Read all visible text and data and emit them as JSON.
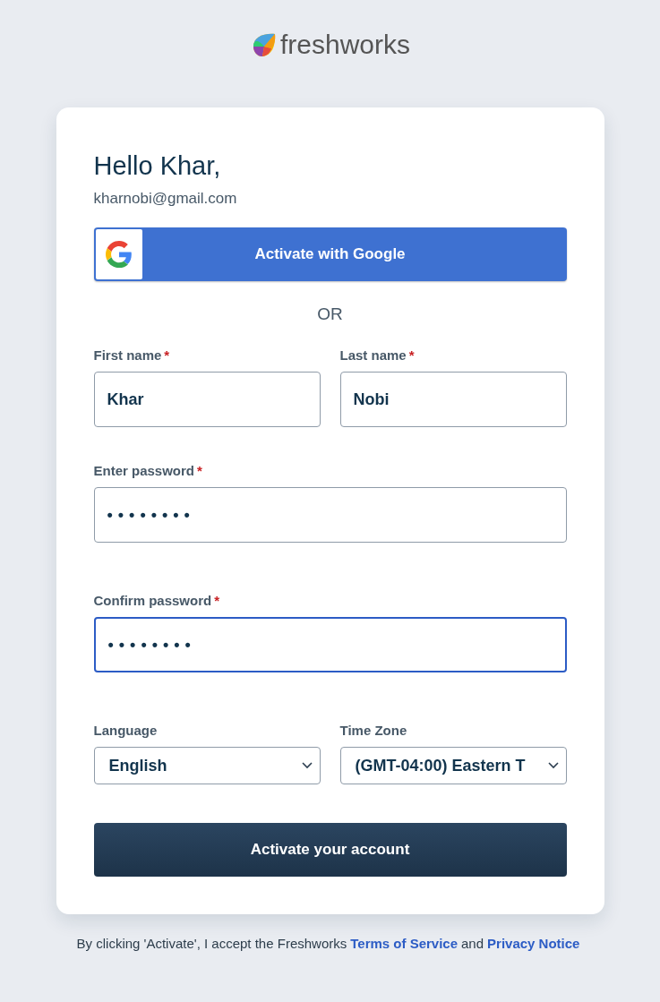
{
  "logo": {
    "text": "freshworks"
  },
  "greeting": "Hello Khar,",
  "email": "kharnobi@gmail.com",
  "google_button": {
    "label": "Activate with Google"
  },
  "divider": "OR",
  "rows": [
    {
      "fields": [
        {
          "kind": "text",
          "label": "First name",
          "required_mark": "*",
          "value": "Khar",
          "focused": false
        },
        {
          "kind": "text",
          "label": "Last name",
          "required_mark": "*",
          "value": "Nobi",
          "focused": false
        }
      ]
    },
    {
      "fields": [
        {
          "kind": "password",
          "label": "Enter password",
          "required_mark": "*",
          "value": "••••••••",
          "focused": false
        }
      ]
    },
    {
      "fields": [
        {
          "kind": "password",
          "label": "Confirm password",
          "required_mark": "*",
          "value": "••••••••",
          "focused": true
        }
      ]
    },
    {
      "fields": [
        {
          "kind": "select",
          "label": "Language",
          "value": "English",
          "focused": false
        },
        {
          "kind": "select",
          "label": "Time Zone",
          "value": "(GMT-04:00) Eastern T",
          "focused": false
        }
      ]
    }
  ],
  "submit_button": {
    "label": "Activate your account"
  },
  "footer": {
    "text": "By clicking 'Activate', I accept the Freshworks",
    "terms_link": "Terms of Service",
    "joiner": "and",
    "privacy_link": "Privacy Notice"
  }
}
